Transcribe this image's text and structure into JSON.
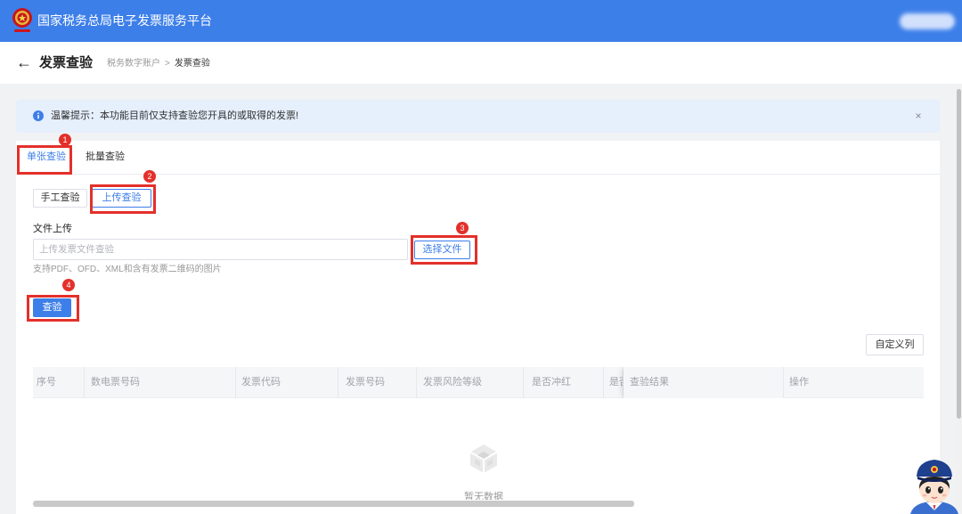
{
  "header": {
    "logo_icon": "tax-emblem-icon",
    "title": "国家税务总局电子发票服务平台"
  },
  "page": {
    "back_icon": "arrow-left-icon",
    "back_glyph": "←",
    "title": "发票查验",
    "breadcrumb": [
      "税务数字账户",
      "发票查验"
    ],
    "breadcrumb_separator": ">"
  },
  "alert": {
    "icon": "info-icon",
    "text": "温馨提示：本功能目前仅支持查验您开具的或取得的发票!",
    "close_glyph": "×"
  },
  "tabs": [
    {
      "label": "单张查验",
      "active": true
    },
    {
      "label": "批量查验",
      "active": false
    }
  ],
  "mode_buttons": [
    {
      "label": "手工查验",
      "active": false
    },
    {
      "label": "上传查验",
      "active": true
    }
  ],
  "upload": {
    "label": "文件上传",
    "placeholder": "上传发票文件查验",
    "value": "",
    "choose_button": "选择文件",
    "hint": "支持PDF、OFD、XML和含有发票二维码的图片"
  },
  "submit_button": "查验",
  "customize_columns_button": "自定义列",
  "table": {
    "columns": [
      "序号",
      "数电票号码",
      "发票代码",
      "发票号码",
      "发票风险等级",
      "是否冲红",
      "是否",
      "查验结果",
      "操作"
    ],
    "rows": [],
    "empty_icon": "empty-box-icon",
    "empty_text": "暂无数据"
  },
  "annotations": [
    "1",
    "2",
    "3",
    "4"
  ],
  "assistant": {
    "icon": "tax-officer-mascot-icon"
  },
  "colors": {
    "primary": "#3d7fe9",
    "annotation_red": "#e3302a",
    "alert_bg": "#e6effc",
    "page_bg": "#f1f2f4"
  }
}
